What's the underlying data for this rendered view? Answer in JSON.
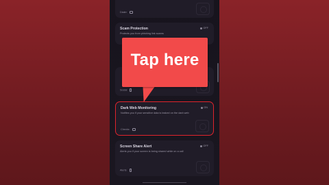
{
  "cards": [
    {
      "title": "",
      "description": "",
      "status": "",
      "footer": "Dialer"
    },
    {
      "title": "Scam Protection",
      "description": "Protects you from phishing link scams",
      "status": "OFF",
      "footer": ""
    },
    {
      "title": "",
      "description": "",
      "status": "",
      "footer": "Social"
    },
    {
      "title": "Dark Web Monitoring",
      "description": "Notifies you if your sensitive data is leaked on the dark web",
      "status": "ON",
      "footer": "Checks"
    },
    {
      "title": "Screen Share Alert",
      "description": "Alerts you if your screen is being shared while on a call",
      "status": "OFF",
      "footer": "Alerts"
    }
  ],
  "callout": {
    "text": "Tap here"
  },
  "colors": {
    "highlight": "#e1242c",
    "callout": "#f24a4a",
    "background": "#7a1f24"
  }
}
